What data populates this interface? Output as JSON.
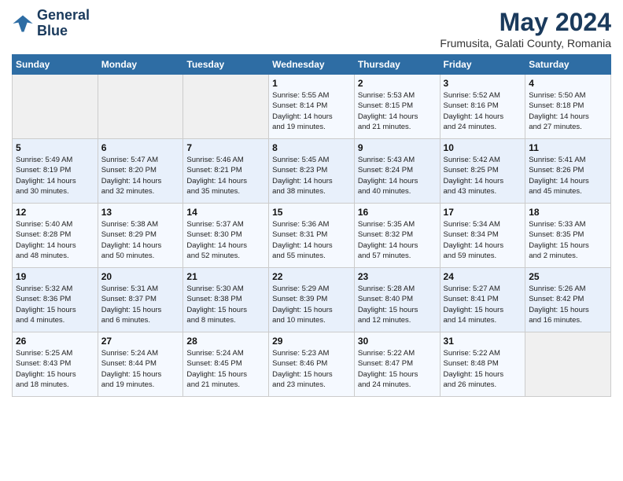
{
  "header": {
    "logo_line1": "General",
    "logo_line2": "Blue",
    "month_year": "May 2024",
    "location": "Frumusita, Galati County, Romania"
  },
  "weekdays": [
    "Sunday",
    "Monday",
    "Tuesday",
    "Wednesday",
    "Thursday",
    "Friday",
    "Saturday"
  ],
  "weeks": [
    [
      {
        "day": "",
        "info": ""
      },
      {
        "day": "",
        "info": ""
      },
      {
        "day": "",
        "info": ""
      },
      {
        "day": "1",
        "info": "Sunrise: 5:55 AM\nSunset: 8:14 PM\nDaylight: 14 hours\nand 19 minutes."
      },
      {
        "day": "2",
        "info": "Sunrise: 5:53 AM\nSunset: 8:15 PM\nDaylight: 14 hours\nand 21 minutes."
      },
      {
        "day": "3",
        "info": "Sunrise: 5:52 AM\nSunset: 8:16 PM\nDaylight: 14 hours\nand 24 minutes."
      },
      {
        "day": "4",
        "info": "Sunrise: 5:50 AM\nSunset: 8:18 PM\nDaylight: 14 hours\nand 27 minutes."
      }
    ],
    [
      {
        "day": "5",
        "info": "Sunrise: 5:49 AM\nSunset: 8:19 PM\nDaylight: 14 hours\nand 30 minutes."
      },
      {
        "day": "6",
        "info": "Sunrise: 5:47 AM\nSunset: 8:20 PM\nDaylight: 14 hours\nand 32 minutes."
      },
      {
        "day": "7",
        "info": "Sunrise: 5:46 AM\nSunset: 8:21 PM\nDaylight: 14 hours\nand 35 minutes."
      },
      {
        "day": "8",
        "info": "Sunrise: 5:45 AM\nSunset: 8:23 PM\nDaylight: 14 hours\nand 38 minutes."
      },
      {
        "day": "9",
        "info": "Sunrise: 5:43 AM\nSunset: 8:24 PM\nDaylight: 14 hours\nand 40 minutes."
      },
      {
        "day": "10",
        "info": "Sunrise: 5:42 AM\nSunset: 8:25 PM\nDaylight: 14 hours\nand 43 minutes."
      },
      {
        "day": "11",
        "info": "Sunrise: 5:41 AM\nSunset: 8:26 PM\nDaylight: 14 hours\nand 45 minutes."
      }
    ],
    [
      {
        "day": "12",
        "info": "Sunrise: 5:40 AM\nSunset: 8:28 PM\nDaylight: 14 hours\nand 48 minutes."
      },
      {
        "day": "13",
        "info": "Sunrise: 5:38 AM\nSunset: 8:29 PM\nDaylight: 14 hours\nand 50 minutes."
      },
      {
        "day": "14",
        "info": "Sunrise: 5:37 AM\nSunset: 8:30 PM\nDaylight: 14 hours\nand 52 minutes."
      },
      {
        "day": "15",
        "info": "Sunrise: 5:36 AM\nSunset: 8:31 PM\nDaylight: 14 hours\nand 55 minutes."
      },
      {
        "day": "16",
        "info": "Sunrise: 5:35 AM\nSunset: 8:32 PM\nDaylight: 14 hours\nand 57 minutes."
      },
      {
        "day": "17",
        "info": "Sunrise: 5:34 AM\nSunset: 8:34 PM\nDaylight: 14 hours\nand 59 minutes."
      },
      {
        "day": "18",
        "info": "Sunrise: 5:33 AM\nSunset: 8:35 PM\nDaylight: 15 hours\nand 2 minutes."
      }
    ],
    [
      {
        "day": "19",
        "info": "Sunrise: 5:32 AM\nSunset: 8:36 PM\nDaylight: 15 hours\nand 4 minutes."
      },
      {
        "day": "20",
        "info": "Sunrise: 5:31 AM\nSunset: 8:37 PM\nDaylight: 15 hours\nand 6 minutes."
      },
      {
        "day": "21",
        "info": "Sunrise: 5:30 AM\nSunset: 8:38 PM\nDaylight: 15 hours\nand 8 minutes."
      },
      {
        "day": "22",
        "info": "Sunrise: 5:29 AM\nSunset: 8:39 PM\nDaylight: 15 hours\nand 10 minutes."
      },
      {
        "day": "23",
        "info": "Sunrise: 5:28 AM\nSunset: 8:40 PM\nDaylight: 15 hours\nand 12 minutes."
      },
      {
        "day": "24",
        "info": "Sunrise: 5:27 AM\nSunset: 8:41 PM\nDaylight: 15 hours\nand 14 minutes."
      },
      {
        "day": "25",
        "info": "Sunrise: 5:26 AM\nSunset: 8:42 PM\nDaylight: 15 hours\nand 16 minutes."
      }
    ],
    [
      {
        "day": "26",
        "info": "Sunrise: 5:25 AM\nSunset: 8:43 PM\nDaylight: 15 hours\nand 18 minutes."
      },
      {
        "day": "27",
        "info": "Sunrise: 5:24 AM\nSunset: 8:44 PM\nDaylight: 15 hours\nand 19 minutes."
      },
      {
        "day": "28",
        "info": "Sunrise: 5:24 AM\nSunset: 8:45 PM\nDaylight: 15 hours\nand 21 minutes."
      },
      {
        "day": "29",
        "info": "Sunrise: 5:23 AM\nSunset: 8:46 PM\nDaylight: 15 hours\nand 23 minutes."
      },
      {
        "day": "30",
        "info": "Sunrise: 5:22 AM\nSunset: 8:47 PM\nDaylight: 15 hours\nand 24 minutes."
      },
      {
        "day": "31",
        "info": "Sunrise: 5:22 AM\nSunset: 8:48 PM\nDaylight: 15 hours\nand 26 minutes."
      },
      {
        "day": "",
        "info": ""
      }
    ]
  ]
}
